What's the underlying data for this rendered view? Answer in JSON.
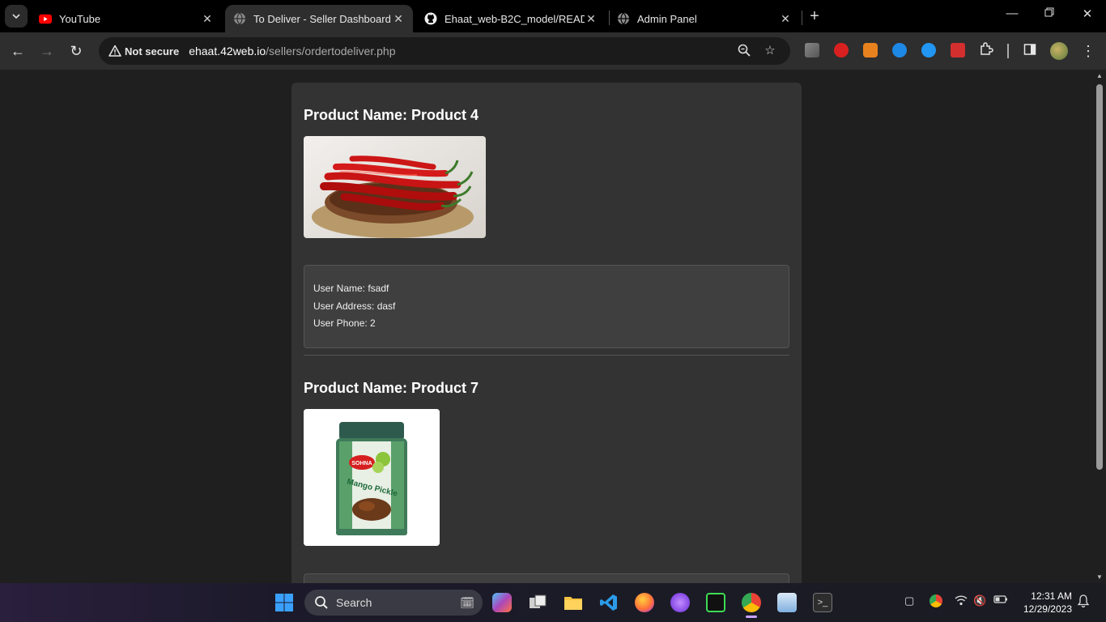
{
  "browser": {
    "tabs": [
      {
        "title": "YouTube",
        "favicon": "youtube-icon",
        "active": false
      },
      {
        "title": "To Deliver - Seller Dashboard",
        "favicon": "globe-icon",
        "active": true
      },
      {
        "title": "Ehaat_web-B2C_model/READM",
        "favicon": "github-icon",
        "active": false
      },
      {
        "title": "Admin Panel",
        "favicon": "globe-icon",
        "active": false
      }
    ],
    "security_label": "Not secure",
    "url_host": "ehaat.42web.io",
    "url_path": "/sellers/ordertodeliver.php"
  },
  "orders": [
    {
      "product_title": "Product Name: Product 4",
      "image_alt": "red-chili-peppers",
      "user_name": "User Name: fsadf",
      "user_address": "User Address: dasf",
      "user_phone": "User Phone: 2"
    },
    {
      "product_title": "Product Name: Product 7",
      "image_alt": "mango-pickle-jar",
      "pickle_brand": "SOHNA",
      "pickle_name": "Mango Pickle"
    }
  ],
  "taskbar": {
    "search_label": "Search",
    "time": "12:31 AM",
    "date": "12/29/2023"
  },
  "colors": {
    "page_bg": "#1f1f1f",
    "card_bg": "#333333",
    "userbox_bg": "#3f3f3f"
  }
}
